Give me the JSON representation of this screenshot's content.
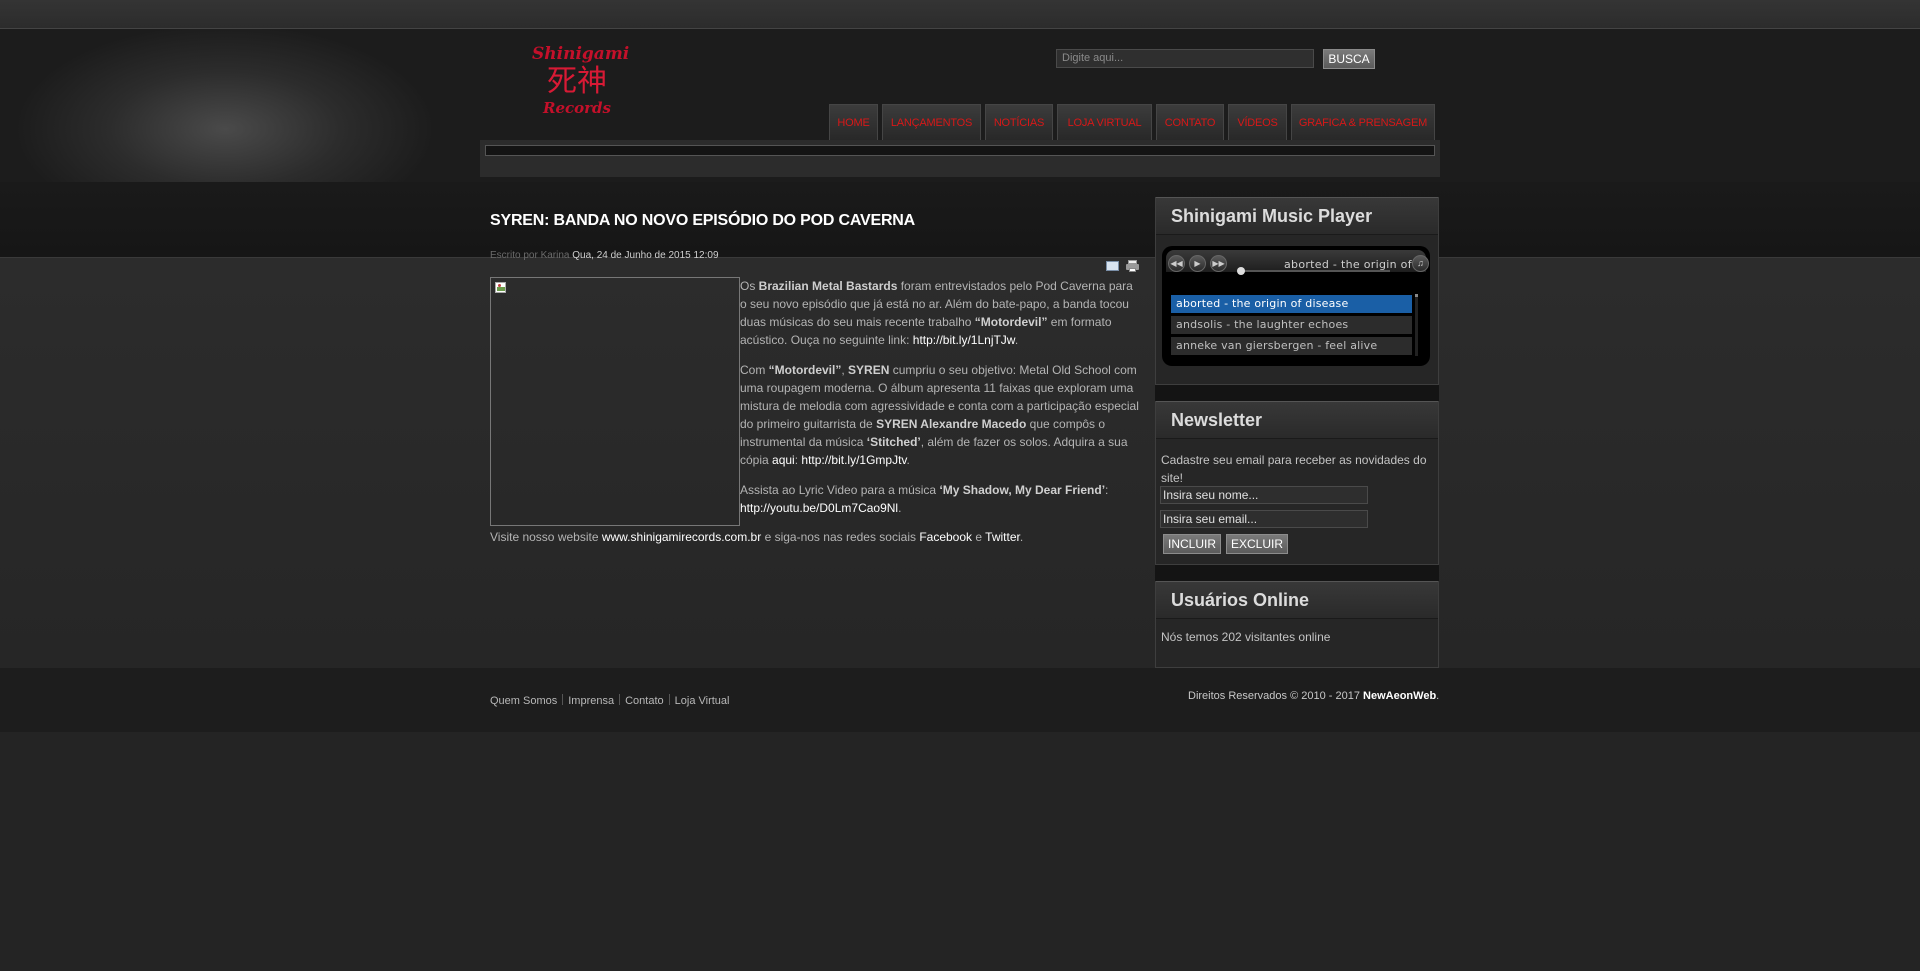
{
  "logo": {
    "line1": "Shinigami",
    "line2": "死神",
    "line3": "Records"
  },
  "search": {
    "placeholder": "Digite aqui...",
    "button": "BUSCA"
  },
  "nav": [
    {
      "label": "HOME"
    },
    {
      "label": "LANÇAMENTOS"
    },
    {
      "label": "NOTÍCIAS"
    },
    {
      "label": "LOJA VIRTUAL"
    },
    {
      "label": "CONTATO"
    },
    {
      "label": "VÍDEOS"
    },
    {
      "label": "GRAFICA & PRENSAGEM"
    }
  ],
  "article": {
    "title": "SYREN: BANDA NO NOVO EPISÓDIO DO POD CAVERNA",
    "author": "Escrito por Karina",
    "date": "Qua, 24 de Junho de 2015 12:09",
    "p1": {
      "t1": "Os ",
      "b1": "Brazilian Metal Bastards",
      "t2": " foram entrevistados pelo Pod Caverna para o seu novo episódio que já está no ar. Além do bate-papo, a banda tocou duas músicas do seu mais recente trabalho ",
      "b2": "“Motordevil”",
      "t3": " em formato acústico. Ouça no seguinte link:  ",
      "link": "http://bit.ly/1LnjTJw",
      "t4": "."
    },
    "p2": {
      "t1": "Com ",
      "b1": "“Motordevil”",
      "t2": ", ",
      "b2": "SYREN",
      "t3": " cumpriu o seu objetivo: Metal Old School com uma roupagem moderna. O álbum apresenta 11 faixas que exploram uma mistura de melodia com agressividade e conta com a participação especial do primeiro guitarrista de ",
      "b3": "SYREN Alexandre Macedo",
      "t4": " que compôs o instrumental da música ",
      "b4": "‘Stitched’",
      "t5": ", além de fazer os solos. Adquira a sua cópia ",
      "link1": "aqui",
      "t6": ": ",
      "link2": "http://bit.ly/1GmpJtv",
      "t7": "."
    },
    "p3": {
      "t1": "Assista ao Lyric Video para a música ",
      "b1": "‘My Shadow, My Dear Friend’",
      "t2": ":",
      "link": "http://youtu.be/D0Lm7Cao9Nl",
      "t3": "."
    },
    "visit": {
      "t1": "Visite nosso website ",
      "link1": "www.shinigamirecords.com.br",
      "t2": " e siga-nos nas redes sociais ",
      "link2": "Facebook",
      "t3": " e ",
      "link3": "Twitter",
      "t4": "."
    }
  },
  "player": {
    "title": "Shinigami Music Player",
    "now_playing": "aborted - the origin of",
    "tracks": [
      "aborted - the origin of disease",
      "andsolis - the laughter echoes",
      "anneke van giersbergen - feel alive"
    ]
  },
  "newsletter": {
    "title": "Newsletter",
    "text": "Cadastre seu email para receber as novidades do site!",
    "name_value": "Insira seu nome...",
    "email_value": "Insira seu email...",
    "include": "INCLUIR",
    "exclude": "EXCLUIR"
  },
  "online": {
    "title": "Usuários Online",
    "text": "Nós temos 202 visitantes online"
  },
  "footer": {
    "links": [
      "Quem Somos",
      "Imprensa",
      "Contato",
      "Loja Virtual"
    ],
    "copyright": "Direitos Reservados © 2010 - 2017 ",
    "brand": "NewAeonWeb",
    "period": "."
  }
}
